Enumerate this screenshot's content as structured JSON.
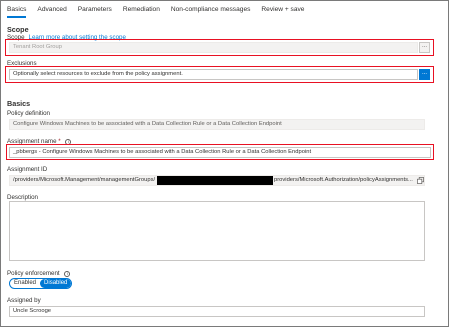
{
  "tabs": [
    {
      "label": "Basics"
    },
    {
      "label": "Advanced"
    },
    {
      "label": "Parameters"
    },
    {
      "label": "Remediation"
    },
    {
      "label": "Non-compliance messages"
    },
    {
      "label": "Review + save"
    }
  ],
  "scope": {
    "heading": "Scope",
    "label": "Scope",
    "learn_more": "Learn more about setting the scope",
    "value": "Tenant Root Group",
    "ellipsis": "..."
  },
  "exclusions": {
    "label": "Exclusions",
    "placeholder": "Optionally select resources to exclude from the policy assignment.",
    "ellipsis": "..."
  },
  "basics": {
    "heading": "Basics",
    "policy_definition_label": "Policy definition",
    "policy_definition_value": "Configure Windows Machines to be associated with a Data Collection Rule or a Data Collection Endpoint",
    "assignment_name_label": "Assignment name",
    "required_marker": "*",
    "info": "i",
    "assignment_name_value": "_pbbergs - Configure Windows Machines to be associated with a Data Collection Rule or a Data Collection Endpoint",
    "assignment_id_label": "Assignment ID",
    "assignment_id_prefix": "/providers/Microsoft.Management/managementGroups/",
    "assignment_id_suffix": "providers/Microsoft.Authorization/policyAssignments...",
    "description_label": "Description",
    "policy_enforcement_label": "Policy enforcement",
    "enforcement_options": [
      "Enabled",
      "Disabled"
    ],
    "enforcement_selected": "Disabled",
    "assigned_by_label": "Assigned by",
    "assigned_by_value": "Uncle Scrooge"
  },
  "colors": {
    "accent": "#0078d4",
    "highlight_border": "#e81123"
  }
}
